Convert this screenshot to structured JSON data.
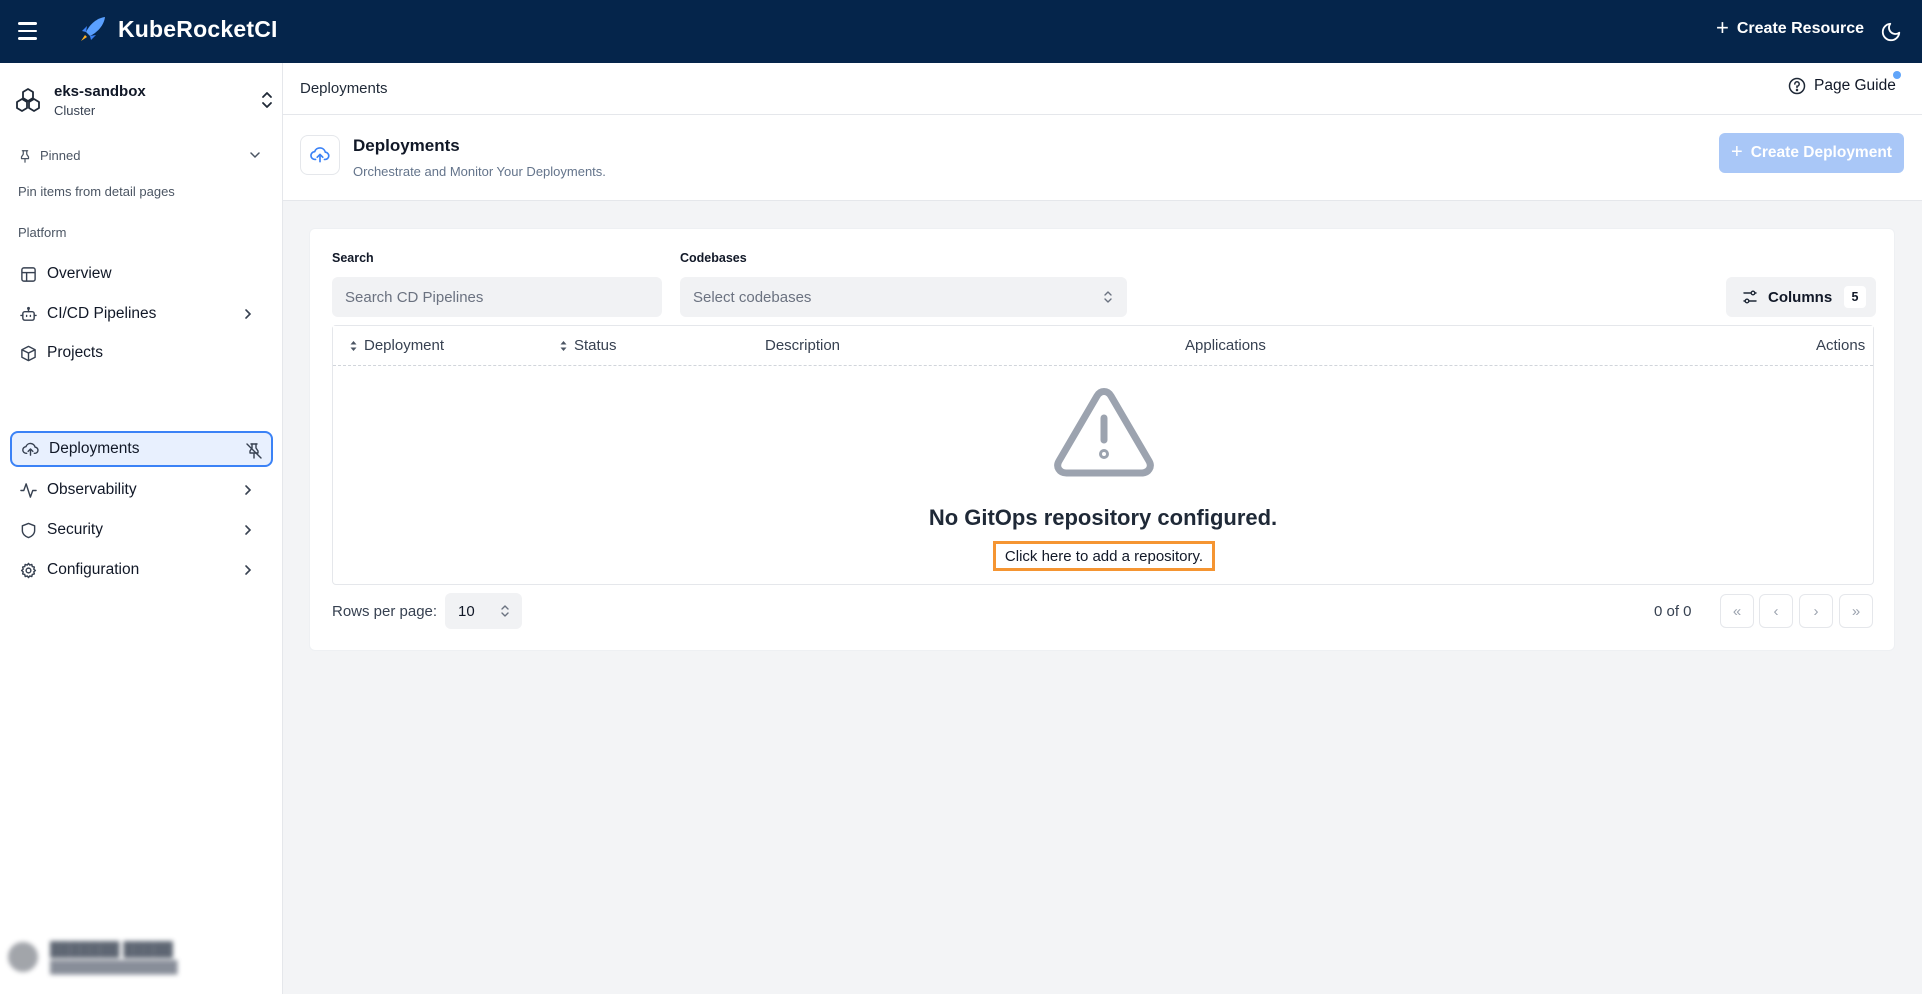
{
  "topbar": {
    "brand": "KubeRocketCI",
    "create_resource_label": "Create Resource",
    "icons": [
      "menu-icon",
      "rocket-logo-icon",
      "plus-icon",
      "moon-icon"
    ]
  },
  "sidebar": {
    "cluster_name": "eks-sandbox",
    "cluster_type": "Cluster",
    "pinned_label": "Pinned",
    "pinned_hint": "Pin items from detail pages",
    "section_label": "Platform",
    "items": [
      {
        "label": "Overview",
        "icon": "layout-icon",
        "has_children": false
      },
      {
        "label": "CI/CD Pipelines",
        "icon": "bot-icon",
        "has_children": true
      },
      {
        "label": "Projects",
        "icon": "package-icon",
        "has_children": false
      },
      {
        "label": "Deployments",
        "icon": "cloud-upload-icon",
        "has_children": false,
        "active": true
      },
      {
        "label": "Observability",
        "icon": "activity-icon",
        "has_children": true
      },
      {
        "label": "Security",
        "icon": "shield-icon",
        "has_children": true
      },
      {
        "label": "Configuration",
        "icon": "gear-icon",
        "has_children": true
      }
    ]
  },
  "breadcrumb": {
    "current": "Deployments",
    "page_guide_label": "Page Guide"
  },
  "header": {
    "title": "Deployments",
    "subtitle": "Orchestrate and Monitor Your Deployments.",
    "create_button": "Create Deployment",
    "create_button_enabled": false
  },
  "filters": {
    "search_label": "Search",
    "search_placeholder": "Search CD Pipelines",
    "codebases_label": "Codebases",
    "codebases_placeholder": "Select codebases",
    "columns_label": "Columns",
    "columns_count": "5"
  },
  "table": {
    "columns": [
      "Deployment",
      "Status",
      "Description",
      "Applications",
      "Actions"
    ],
    "empty_title": "No GitOps repository configured.",
    "empty_link": "Click here to add a repository."
  },
  "pagination": {
    "rows_per_page_label": "Rows per page:",
    "rows_per_page_value": "10",
    "range": "0 of 0",
    "buttons": [
      "«",
      "‹",
      "›",
      "»"
    ]
  },
  "colors": {
    "topbar": "#05254b",
    "accent": "#3b82f6",
    "disabled_button": "#a9c7f7",
    "highlight_outline": "#f59532"
  }
}
